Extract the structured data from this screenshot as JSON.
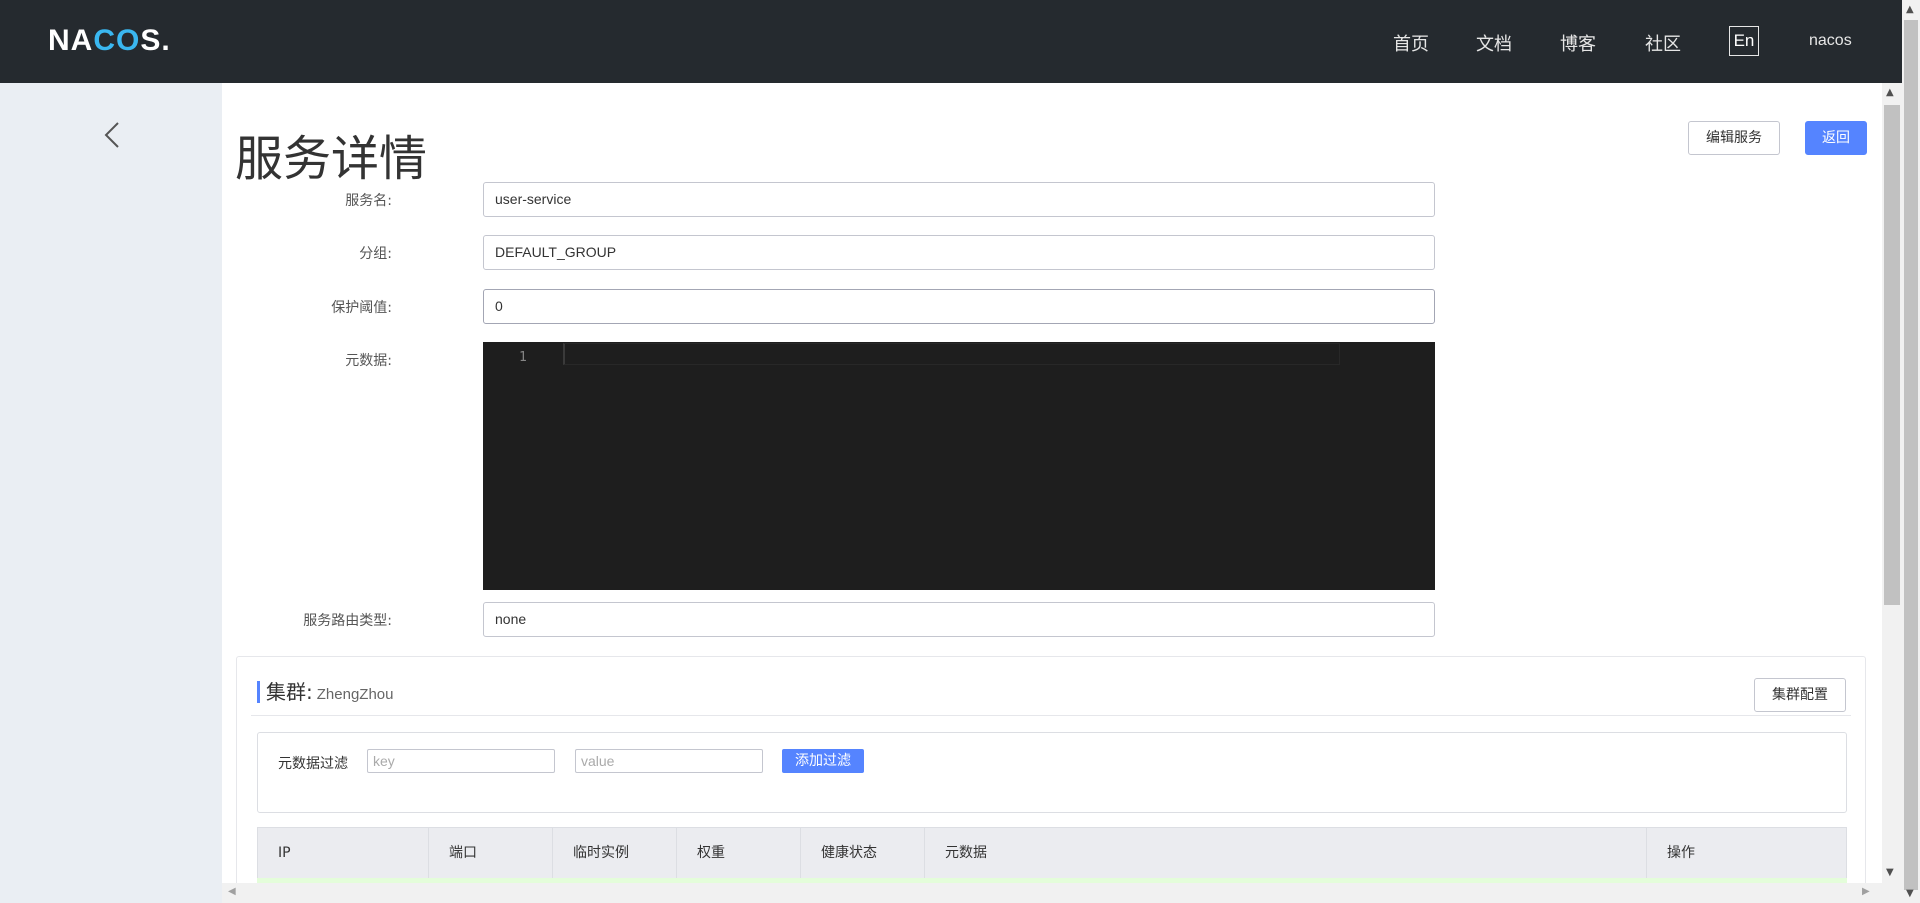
{
  "header": {
    "logo_text": "NACOS.",
    "nav": [
      "首页",
      "文档",
      "博客",
      "社区"
    ],
    "lang_label": "En",
    "user": "nacos"
  },
  "page": {
    "title": "服务详情",
    "edit_button": "编辑服务",
    "back_button": "返回"
  },
  "form": {
    "service_name_label": "服务名:",
    "service_name_value": "user-service",
    "group_label": "分组:",
    "group_value": "DEFAULT_GROUP",
    "threshold_label": "保护阈值:",
    "threshold_value": "0",
    "metadata_label": "元数据:",
    "editor_line_number": "1",
    "router_type_label": "服务路由类型:",
    "router_type_value": "none"
  },
  "cluster": {
    "title": "集群:",
    "name": "ZhengZhou",
    "config_button": "集群配置",
    "filter_label": "元数据过滤",
    "key_placeholder": "key",
    "value_placeholder": "value",
    "add_filter_button": "添加过滤",
    "columns": [
      "IP",
      "端口",
      "临时实例",
      "权重",
      "健康状态",
      "元数据",
      "操作"
    ]
  },
  "colors": {
    "topbar": "#252a2f",
    "primary": "#5584ff",
    "editor_bg": "#1e1e1e",
    "healthy_row": "#e4fdda"
  }
}
